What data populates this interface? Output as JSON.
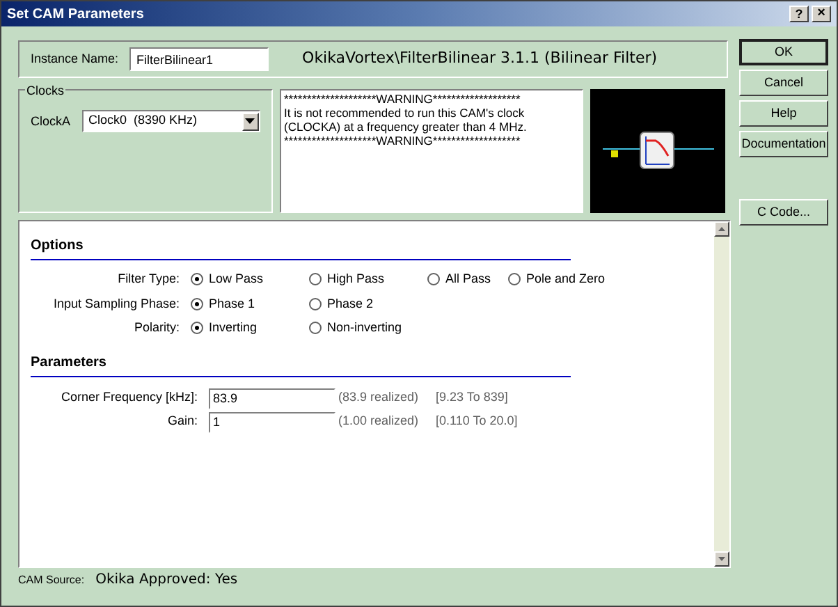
{
  "window": {
    "title": "Set CAM Parameters",
    "help_button": "?",
    "close_button": "×"
  },
  "instance": {
    "label": "Instance Name:",
    "value": "FilterBilinear1",
    "description": "OkikaVortex\\FilterBilinear 3.1.1 (Bilinear Filter)"
  },
  "clocks": {
    "title": "Clocks",
    "label": "ClockA",
    "value": "Clock0  (8390 KHz)"
  },
  "warning_lines": [
    "********************WARNING*******************",
    "It is not recommended to run this CAM's clock (CLOCKA) at a frequency greater than 4 MHz.",
    "********************WARNING*******************"
  ],
  "buttons": [
    {
      "label": "OK",
      "kind": "default"
    },
    {
      "label": "Cancel",
      "kind": "normal"
    },
    {
      "label": "Help",
      "kind": "normal"
    },
    {
      "label": "Documentation",
      "kind": "normal"
    },
    {
      "label": "C Code...",
      "kind": "spaced"
    }
  ],
  "options": {
    "title": "Options",
    "rows": [
      {
        "label": "Filter Type:",
        "choices": [
          {
            "label": "Low Pass",
            "selected": true
          },
          {
            "label": "High Pass",
            "selected": false
          },
          {
            "label": "All Pass",
            "selected": false
          },
          {
            "label": "Pole and Zero",
            "selected": false
          }
        ]
      },
      {
        "label": "Input Sampling Phase:",
        "choices": [
          {
            "label": "Phase 1",
            "selected": true
          },
          {
            "label": "Phase 2",
            "selected": false
          }
        ]
      },
      {
        "label": "Polarity:",
        "choices": [
          {
            "label": "Inverting",
            "selected": true
          },
          {
            "label": "Non-inverting",
            "selected": false
          }
        ]
      }
    ]
  },
  "parameters": {
    "title": "Parameters",
    "rows": [
      {
        "label": "Corner Frequency [kHz]:",
        "value": "83.9",
        "realized": "(83.9 realized)",
        "range": "[9.23 To 839]"
      },
      {
        "label": "Gain:",
        "value": "1",
        "realized": "(1.00 realized)",
        "range": "[0.110 To 20.0]"
      }
    ]
  },
  "status": {
    "label": "CAM Source:",
    "value": "Okika Approved: Yes"
  }
}
